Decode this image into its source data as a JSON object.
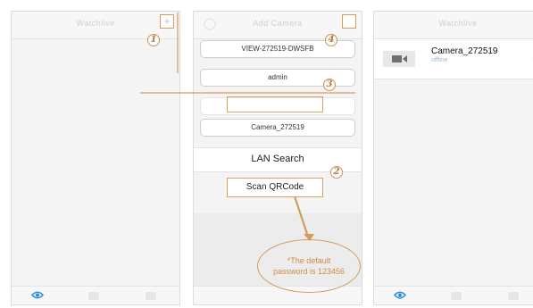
{
  "screen_left": {
    "title": "Watchlive",
    "add_icon": "plus-icon"
  },
  "screen_middle": {
    "title": "Add Camera",
    "uid_value": "VIEW-272519-DWSFB",
    "username_value": "admin",
    "password_value": "",
    "name_value": "Camera_272519",
    "lan_search_label": "LAN Search",
    "scan_qrcode_label": "Scan QRCode"
  },
  "screen_right": {
    "title": "Watchlive",
    "camera_name": "Camera_272519",
    "camera_status": "offline",
    "camera_sub": ""
  },
  "annotations": {
    "step1": "1",
    "step2": "2",
    "step3": "3",
    "step4": "4",
    "note": "*The default password is 123456"
  },
  "colors": {
    "annotation": "#d59a5c",
    "tab_active": "#2e8de0"
  }
}
